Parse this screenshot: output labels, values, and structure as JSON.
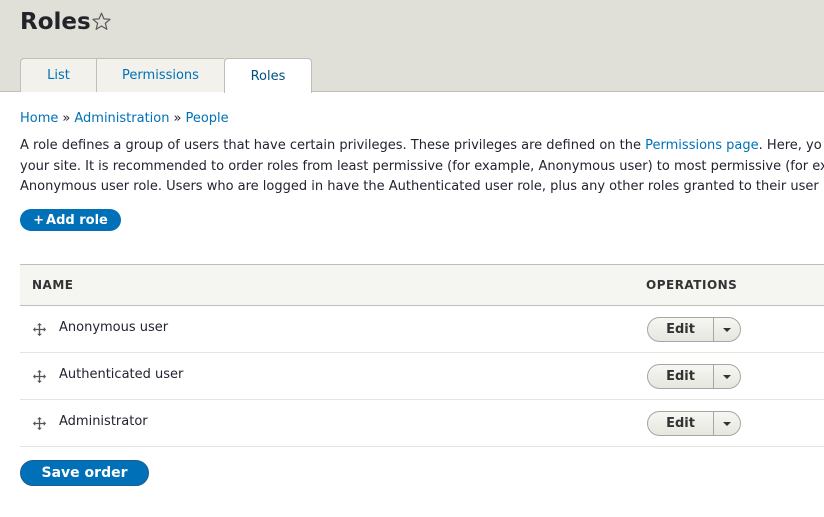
{
  "page": {
    "title": "Roles"
  },
  "tabs": [
    {
      "label": "List"
    },
    {
      "label": "Permissions"
    },
    {
      "label": "Roles"
    }
  ],
  "breadcrumb": [
    {
      "label": "Home"
    },
    {
      "label": "Administration"
    },
    {
      "label": "People"
    }
  ],
  "breadcrumb_separator": "»",
  "description": {
    "line1_before_link": "A role defines a group of users that have certain privileges. These privileges are defined on the ",
    "link": "Permissions page",
    "line1_after_link": ". Here, yo",
    "line2": "your site. It is recommended to order roles from least permissive (for example, Anonymous user) to most permissive (for ex",
    "line3": "Anonymous user role. Users who are logged in have the Authenticated user role, plus any other roles granted to their user"
  },
  "actions": {
    "add_role_icon": "+",
    "add_role_label": "Add role",
    "save_order_label": "Save order"
  },
  "table": {
    "headers": {
      "name": "NAME",
      "operations": "OPERATIONS"
    },
    "rows": [
      {
        "name": "Anonymous user",
        "operation": "Edit"
      },
      {
        "name": "Authenticated user",
        "operation": "Edit"
      },
      {
        "name": "Administrator",
        "operation": "Edit"
      }
    ]
  },
  "icons": {
    "favorite": "star-icon",
    "drag": "drag-handle-icon",
    "dropdown": "caret-down-icon"
  },
  "colors": {
    "link": "#0071b8",
    "primary_button": "#0071b8",
    "header_bg": "#e0e0d8"
  }
}
